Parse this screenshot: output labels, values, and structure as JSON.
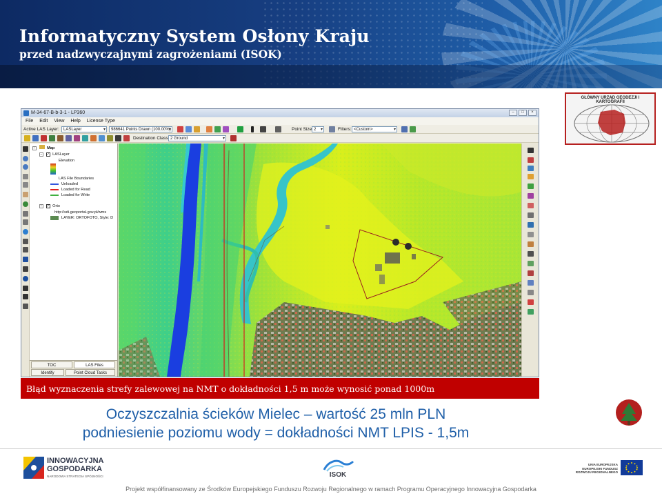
{
  "header": {
    "title": "Informatyczny System Osłony Kraju",
    "subtitle": "przed nadzwyczajnymi zagrożeniami (ISOK)"
  },
  "gugik_logo": {
    "text": "GŁÓWNY URZĄD GEODEZJI I KARTOGRAFII"
  },
  "app": {
    "window_title": "M-34-67-B-b-3-1 - LP360",
    "menu": [
      "File",
      "Edit",
      "View",
      "Help",
      "License Type"
    ],
    "toolbar1": {
      "active_layer_label": "Active LAS Layer:",
      "active_layer_value": "LASLayer",
      "points_drawn": "986641 Points Drawn (100.00%)",
      "point_size_label": "Point Size",
      "point_size_value": "2",
      "filters_label": "Filters:",
      "filters_value": "<Custom>"
    },
    "toolbar2": {
      "destination_class_label": "Destination Class",
      "destination_class_value": "2 Ground"
    },
    "toc": {
      "map_label": "Map",
      "layer_las": "LASLayer",
      "layer_elevation": "Elevation",
      "layer_boundaries": "LAS File Boundaries",
      "legend_unloaded": "Unloaded",
      "legend_loaded_read": "Loaded for Read",
      "legend_loaded_write": "Loaded for Write",
      "layer_orto": "Orto",
      "orto_url": "http://sdi.geoportal.gov.pl/wms",
      "orto_layer": "LAYER: ORTOFOTO, Style: D",
      "tabs": [
        "TOC",
        "LAS Files",
        "Identify",
        "Point Cloud Tasks"
      ]
    }
  },
  "colors": {
    "caption_bg": "#c00000",
    "main_text": "#1f5fa8",
    "legend_unloaded": "#3355dd",
    "legend_loaded_read": "#e02020",
    "legend_loaded_write": "#40b040"
  },
  "caption": "Błąd wyznaczenia strefy zalewowej na NMT o dokładności 1,5 m może wynosić ponad 1000m",
  "main": {
    "line1": "Oczyszczalnia ścieków Mielec – wartość 25 mln PLN",
    "line2": "podniesienie poziomu wody = dokładności NMT LPIS - 1,5m"
  },
  "footer": {
    "ig_title": "INNOWACYJNA GOSPODARKA",
    "ig_sub": "NARODOWA STRATEGIA SPÓJNOŚCI",
    "isok": "ISOK",
    "ue_line1": "UNIA EUROPEJSKA",
    "ue_line2": "EUROPEJSKI FUNDUSZ",
    "ue_line3": "ROZWOJU REGIONALNEGO",
    "note": "Projekt współfinansowany ze Środków Europejskiego Funduszu Rozwoju Regionalnego w ramach Programu Operacyjnego Innowacyjna Gospodarka"
  }
}
